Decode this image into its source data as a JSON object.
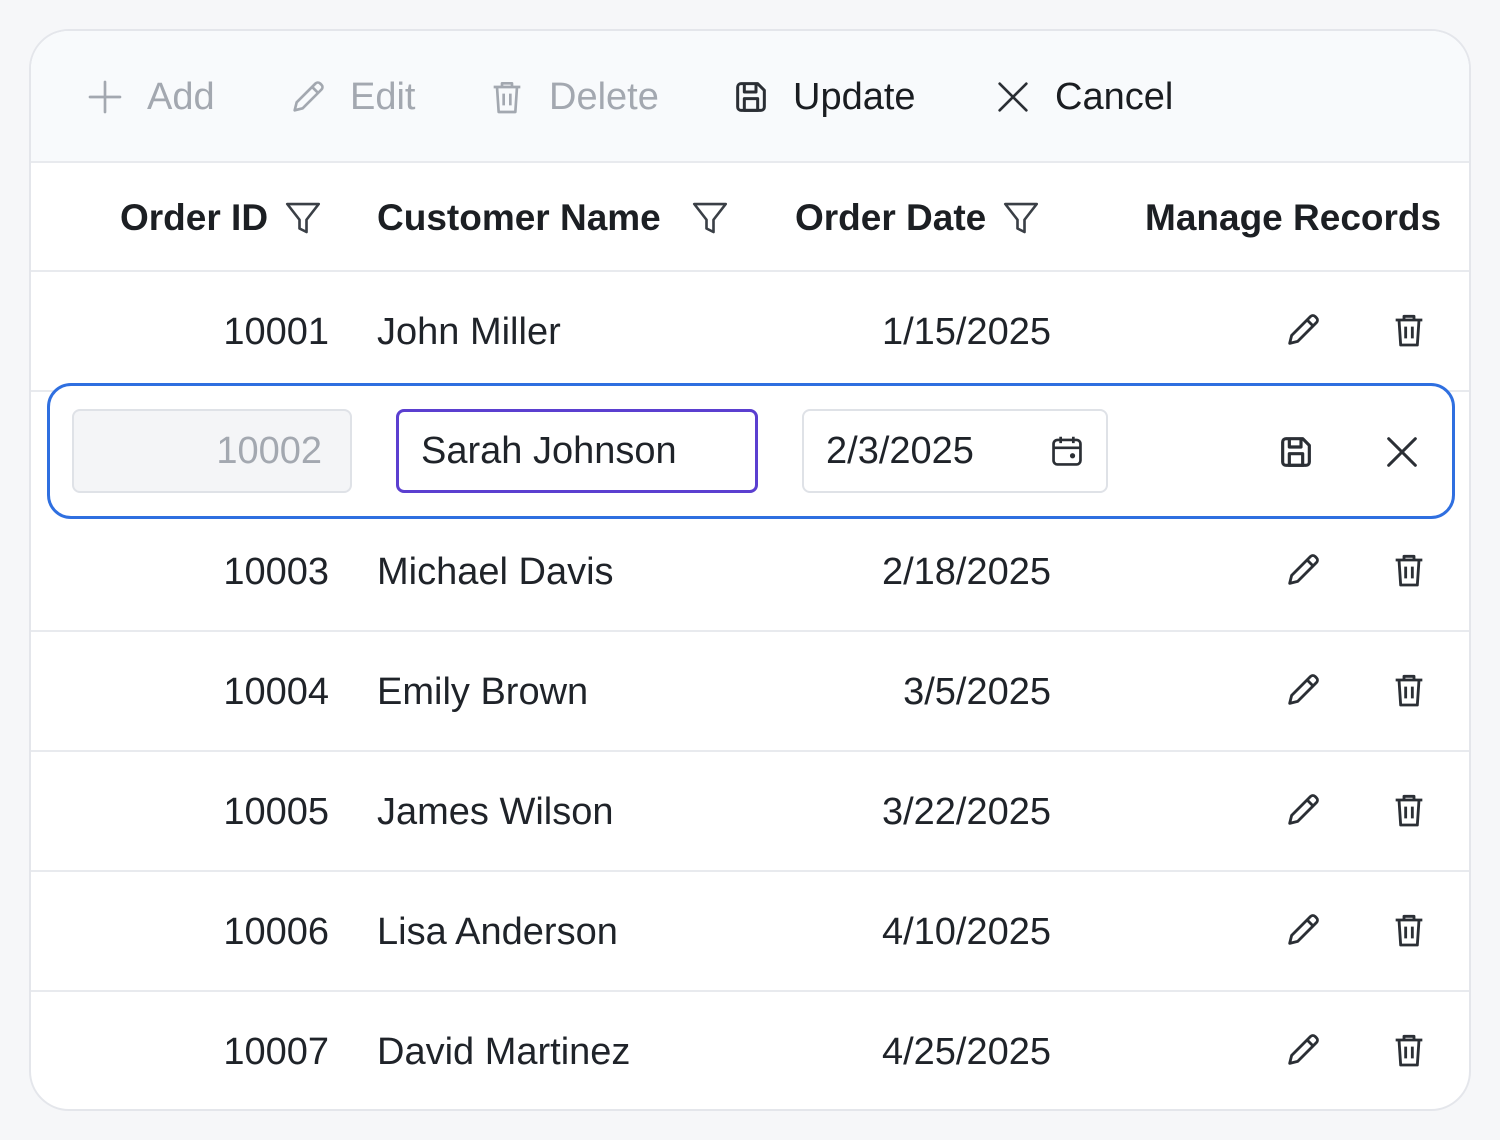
{
  "toolbar": {
    "add_label": "Add",
    "edit_label": "Edit",
    "delete_label": "Delete",
    "update_label": "Update",
    "cancel_label": "Cancel"
  },
  "columns": {
    "order_id": "Order ID",
    "customer_name": "Customer Name",
    "order_date": "Order Date",
    "manage": "Manage Records"
  },
  "rows": [
    {
      "id": "10001",
      "name": "John Miller",
      "date": "1/15/2025"
    },
    {
      "id": "10002",
      "name": "Sarah Johnson",
      "date": "2/3/2025",
      "editing": true
    },
    {
      "id": "10003",
      "name": "Michael Davis",
      "date": "2/18/2025"
    },
    {
      "id": "10004",
      "name": "Emily Brown",
      "date": "3/5/2025"
    },
    {
      "id": "10005",
      "name": "James Wilson",
      "date": "3/22/2025"
    },
    {
      "id": "10006",
      "name": "Lisa Anderson",
      "date": "4/10/2025"
    },
    {
      "id": "10007",
      "name": "David Martinez",
      "date": "4/25/2025"
    }
  ],
  "icons": {
    "add": "plus-icon",
    "edit": "pencil-icon",
    "delete": "trash-icon",
    "update": "save-icon",
    "cancel": "close-icon",
    "filter": "filter-icon",
    "calendar": "calendar-icon"
  },
  "colors": {
    "accent": "#2f6fe0",
    "focus": "#5b3fd0",
    "disabled_text": "#a3a8b0"
  }
}
